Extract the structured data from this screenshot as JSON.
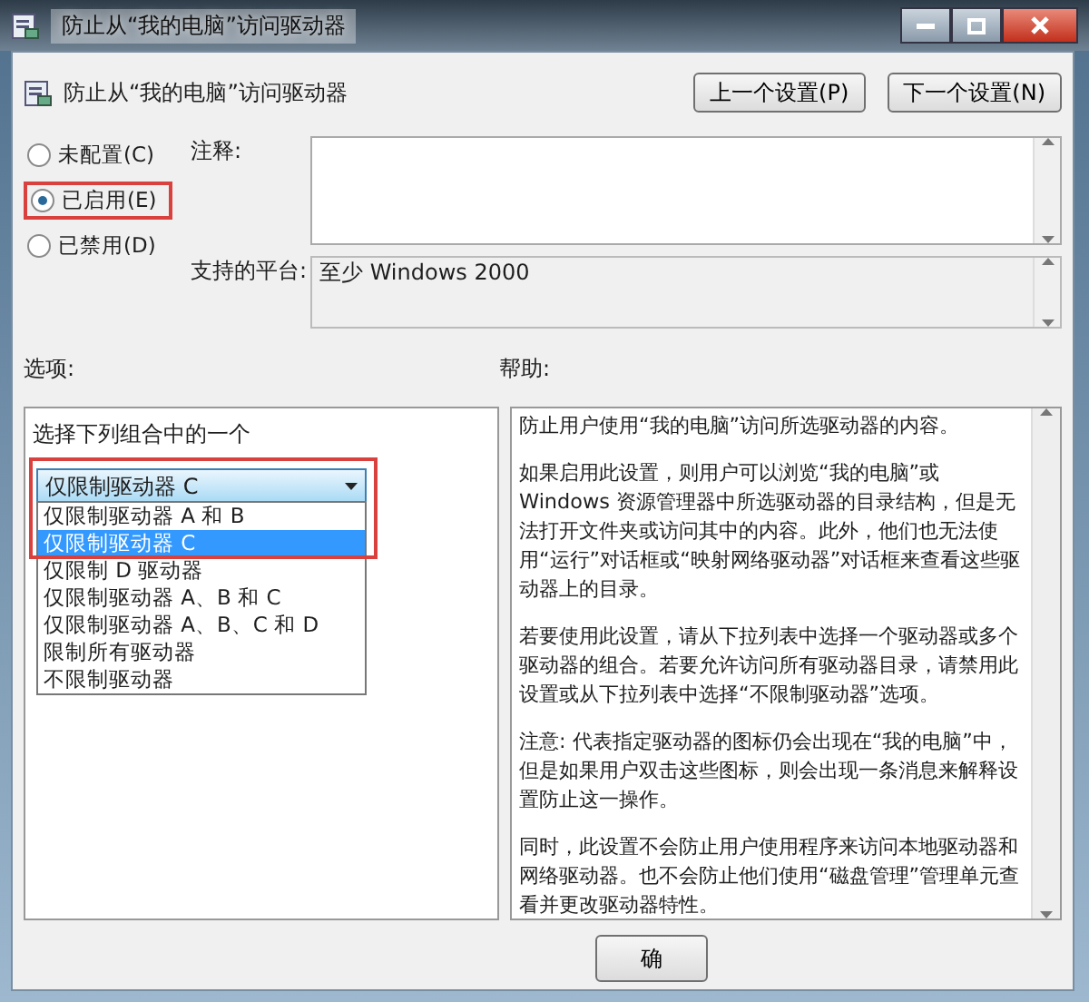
{
  "window": {
    "title": "防止从“我的电脑”访问驱动器"
  },
  "setting_title": "防止从“我的电脑”访问驱动器",
  "nav_buttons": [
    "上一个设置(P)",
    "下一个设置(N)"
  ],
  "radios": [
    {
      "label": "未配置(C)",
      "selected": false,
      "highlighted": false
    },
    {
      "label": "已启用(E)",
      "selected": true,
      "highlighted": true
    },
    {
      "label": "已禁用(D)",
      "selected": false,
      "highlighted": false
    }
  ],
  "comment": {
    "label": "注释:"
  },
  "platform": {
    "label": "支持的平台:",
    "value": "至少 Windows 2000"
  },
  "options": {
    "label": "选项:",
    "prompt": "选择下列组合中的一个",
    "dropdown": {
      "value": "仅限制驱动器 C",
      "highlighted": true,
      "expanded": true,
      "items": [
        {
          "label": "仅限制驱动器 A 和 B",
          "selected": false
        },
        {
          "label": "仅限制驱动器 C",
          "selected": true
        },
        {
          "label": "仅限制 D 驱动器",
          "selected": false
        },
        {
          "label": "仅限制驱动器 A、B 和 C",
          "selected": false
        },
        {
          "label": "仅限制驱动器 A、B、C 和 D",
          "selected": false
        },
        {
          "label": "限制所有驱动器",
          "selected": false
        },
        {
          "label": "不限制驱动器",
          "selected": false
        }
      ]
    }
  },
  "help": {
    "label": "帮助:",
    "paragraphs": [
      "防止用户使用“我的电脑”访问所选驱动器的内容。",
      "如果启用此设置，则用户可以浏览“我的电脑”或 Windows 资源管理器中所选驱动器的目录结构，但是无法打开文件夹或访问其中的内容。此外，他们也无法使用“运行”对话框或“映射网络驱动器”对话框来查看这些驱动器上的目录。",
      "若要使用此设置，请从下拉列表中选择一个驱动器或多个驱动器的组合。若要允许访问所有驱动器目录，请禁用此设置或从下拉列表中选择“不限制驱动器”选项。",
      "注意: 代表指定驱动器的图标仍会出现在“我的电脑”中，但是如果用户双击这些图标，则会出现一条消息来解释设置防止这一操作。",
      "同时，此设置不会防止用户使用程序来访问本地驱动器和网络驱动器。也不会防止他们使用“磁盘管理”管理单元查看并更改驱动器特性。"
    ]
  },
  "footer_buttons": [
    "确"
  ]
}
